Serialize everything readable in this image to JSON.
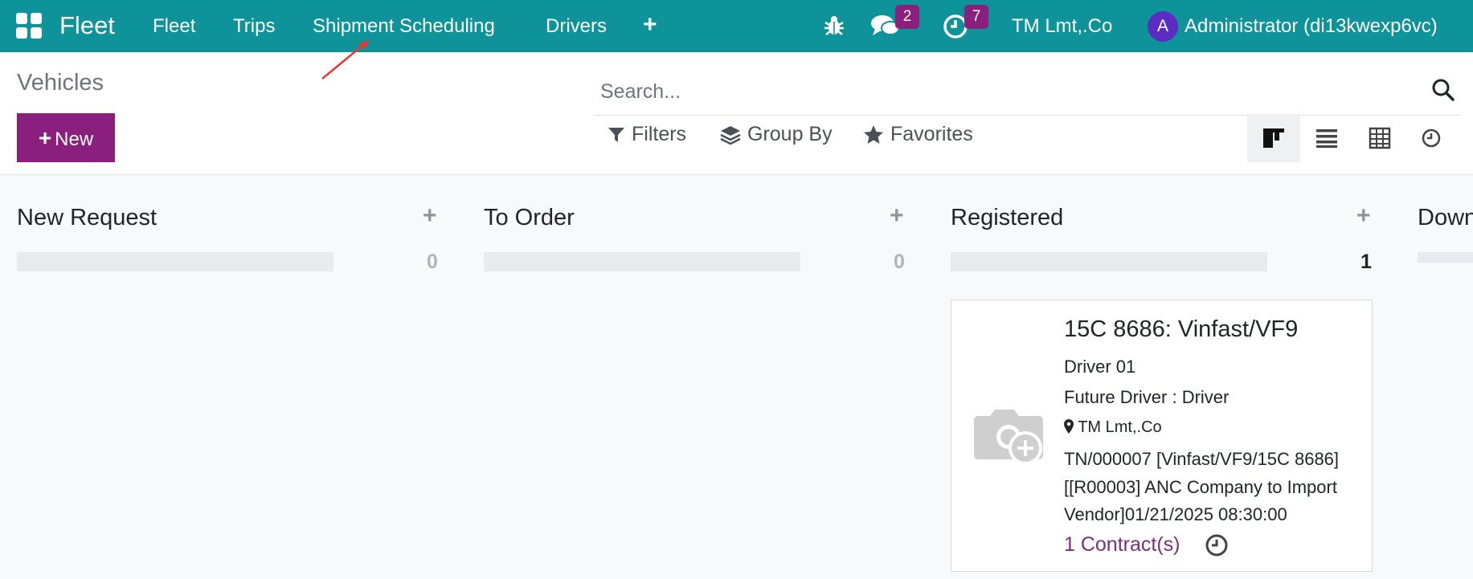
{
  "navbar": {
    "brand": "Fleet",
    "menu": [
      "Fleet",
      "Trips",
      "Shipment Scheduling",
      "Drivers"
    ],
    "plus": "+",
    "messages_count": "2",
    "activities_count": "7",
    "company": "TM Lmt,.Co",
    "avatar_letter": "A",
    "user": "Administrator (di13kwexp6vc)"
  },
  "control": {
    "breadcrumb": "Vehicles",
    "new_label": "New",
    "search_placeholder": "Search...",
    "filters_label": "Filters",
    "group_by_label": "Group By",
    "favorites_label": "Favorites"
  },
  "kanban": {
    "columns": [
      {
        "title": "New Request",
        "count": "0"
      },
      {
        "title": "To Order",
        "count": "0"
      },
      {
        "title": "Registered",
        "count": "1"
      },
      {
        "title": "Down"
      }
    ],
    "card": {
      "title": "15C 8686: Vinfast/VF9",
      "driver": "Driver 01",
      "future_driver": "Future Driver : Driver",
      "location": "TM Lmt,.Co",
      "trip_line1": "TN/000007 [Vinfast/VF9/15C 8686]",
      "trip_line2": "[[R00003] ANC Company to Import",
      "trip_line3": "Vendor]01/21/2025 08:30:00",
      "contracts": "1 Contract(s)"
    }
  },
  "colors": {
    "navbar": "#0f939a",
    "primary": "#8a1f7d",
    "annotation_arrow": "#e53935"
  },
  "icons": [
    "apps-icon",
    "plus-icon",
    "bug-icon",
    "chat-icon",
    "clock-icon",
    "search-icon",
    "filter-icon",
    "layers-icon",
    "star-icon",
    "kanban-icon",
    "list-icon",
    "pivot-icon",
    "activity-icon",
    "camera-plus-icon",
    "map-marker-icon"
  ]
}
